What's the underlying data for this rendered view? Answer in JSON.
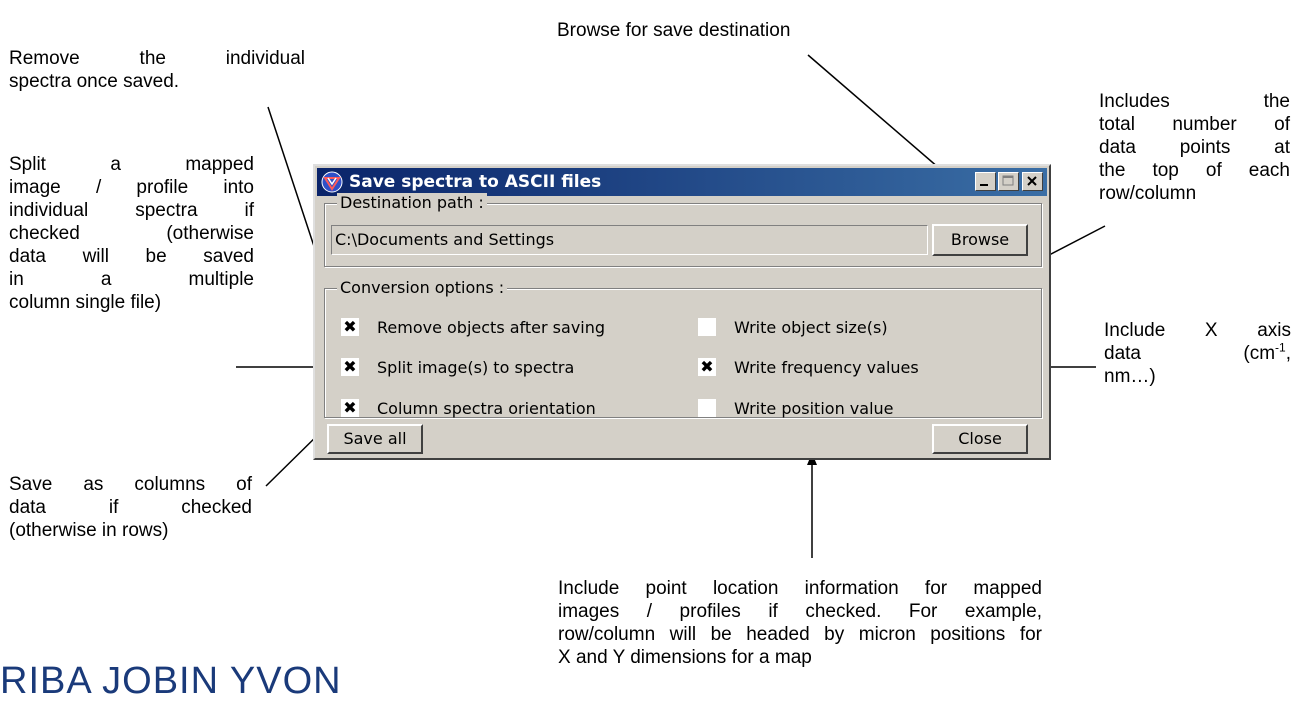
{
  "dialog": {
    "title": "Save spectra to ASCII files",
    "destination_group_label": "Destination path :",
    "destination_value": "C:\\Documents and Settings",
    "browse_label": "Browse",
    "conversion_group_label": "Conversion options :",
    "options": [
      {
        "label": "Remove objects after saving",
        "checked": true,
        "mark": "✖"
      },
      {
        "label": "Split image(s) to spectra",
        "checked": true,
        "mark": "✖"
      },
      {
        "label": "Column spectra orientation",
        "checked": true,
        "mark": "✖"
      },
      {
        "label": "Write object size(s)",
        "checked": false,
        "mark": ""
      },
      {
        "label": "Write frequency values",
        "checked": true,
        "mark": "✖"
      },
      {
        "label": "Write position value",
        "checked": false,
        "mark": ""
      }
    ],
    "save_all_label": "Save all",
    "close_label": "Close",
    "titlebar_buttons": {
      "minimize": "_",
      "maximize": "□",
      "close": "✕"
    }
  },
  "annotations": {
    "browse": "Browse for save destination",
    "remove_lines": [
      "Remove the individual",
      "spectra once saved."
    ],
    "split_lines": [
      "Split a mapped",
      "image / profile into",
      "individual spectra if",
      "checked (otherwise",
      "data will be saved",
      "in a multiple",
      "column single file)"
    ],
    "columns_lines": [
      "Save as columns of",
      "data if checked",
      "(otherwise in rows)"
    ],
    "object_size_lines": [
      "Includes the",
      "total number of",
      "data points at",
      "the top of each",
      "row/column"
    ],
    "x_axis_line1": "Include X axis",
    "x_axis_line2_a": "data",
    "x_axis_line2_b": "(cm",
    "x_axis_sup": "-1",
    "x_axis_line2_c": ",",
    "x_axis_line3": "nm…)",
    "position_lines": [
      "Include point location information for mapped",
      "images / profiles if checked. For example,",
      "row/column will be headed by micron positions for",
      "X and Y dimensions for a map"
    ]
  },
  "logo_text": "RIBA JOBIN YVON",
  "colors": {
    "titlebar_start": "#0a246a",
    "titlebar_end": "#3a6ea5",
    "dialog_bg": "#d4d0c8"
  }
}
